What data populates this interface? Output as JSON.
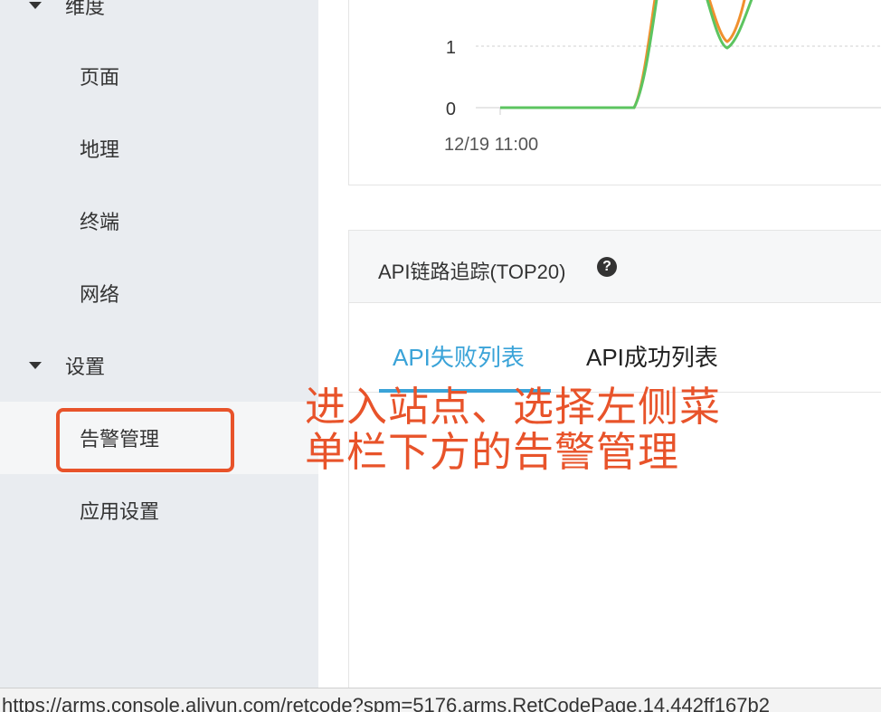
{
  "sidebar": {
    "groups": [
      {
        "label": "维度"
      },
      {
        "label": "设置"
      }
    ],
    "items": [
      {
        "label": "页面"
      },
      {
        "label": "地理"
      },
      {
        "label": "终端"
      },
      {
        "label": "网络"
      },
      {
        "label": "告警管理"
      },
      {
        "label": "应用设置"
      }
    ]
  },
  "chart": {
    "yticks": [
      "1",
      "0"
    ],
    "xtick": "12/19 11:00",
    "colors": {
      "orange": "#f0902e",
      "green": "#5cc460"
    }
  },
  "api_card": {
    "title": "API链路追踪(TOP20)",
    "help_icon": "?",
    "tabs": [
      {
        "label": "API失败列表",
        "active": true
      },
      {
        "label": "API成功列表",
        "active": false
      }
    ]
  },
  "annotation": {
    "line1": "进入站点、选择左侧菜",
    "line2": "单栏下方的告警管理",
    "color": "#e8532a"
  },
  "status_bar": {
    "url": "https://arms.console.aliyun.com/retcode?spm=5176.arms.RetCodePage.14.442ff167b2"
  },
  "colors": {
    "accent": "#3aa3d8",
    "sidebar_bg": "#e9ecf0",
    "highlight": "#e8532a"
  }
}
